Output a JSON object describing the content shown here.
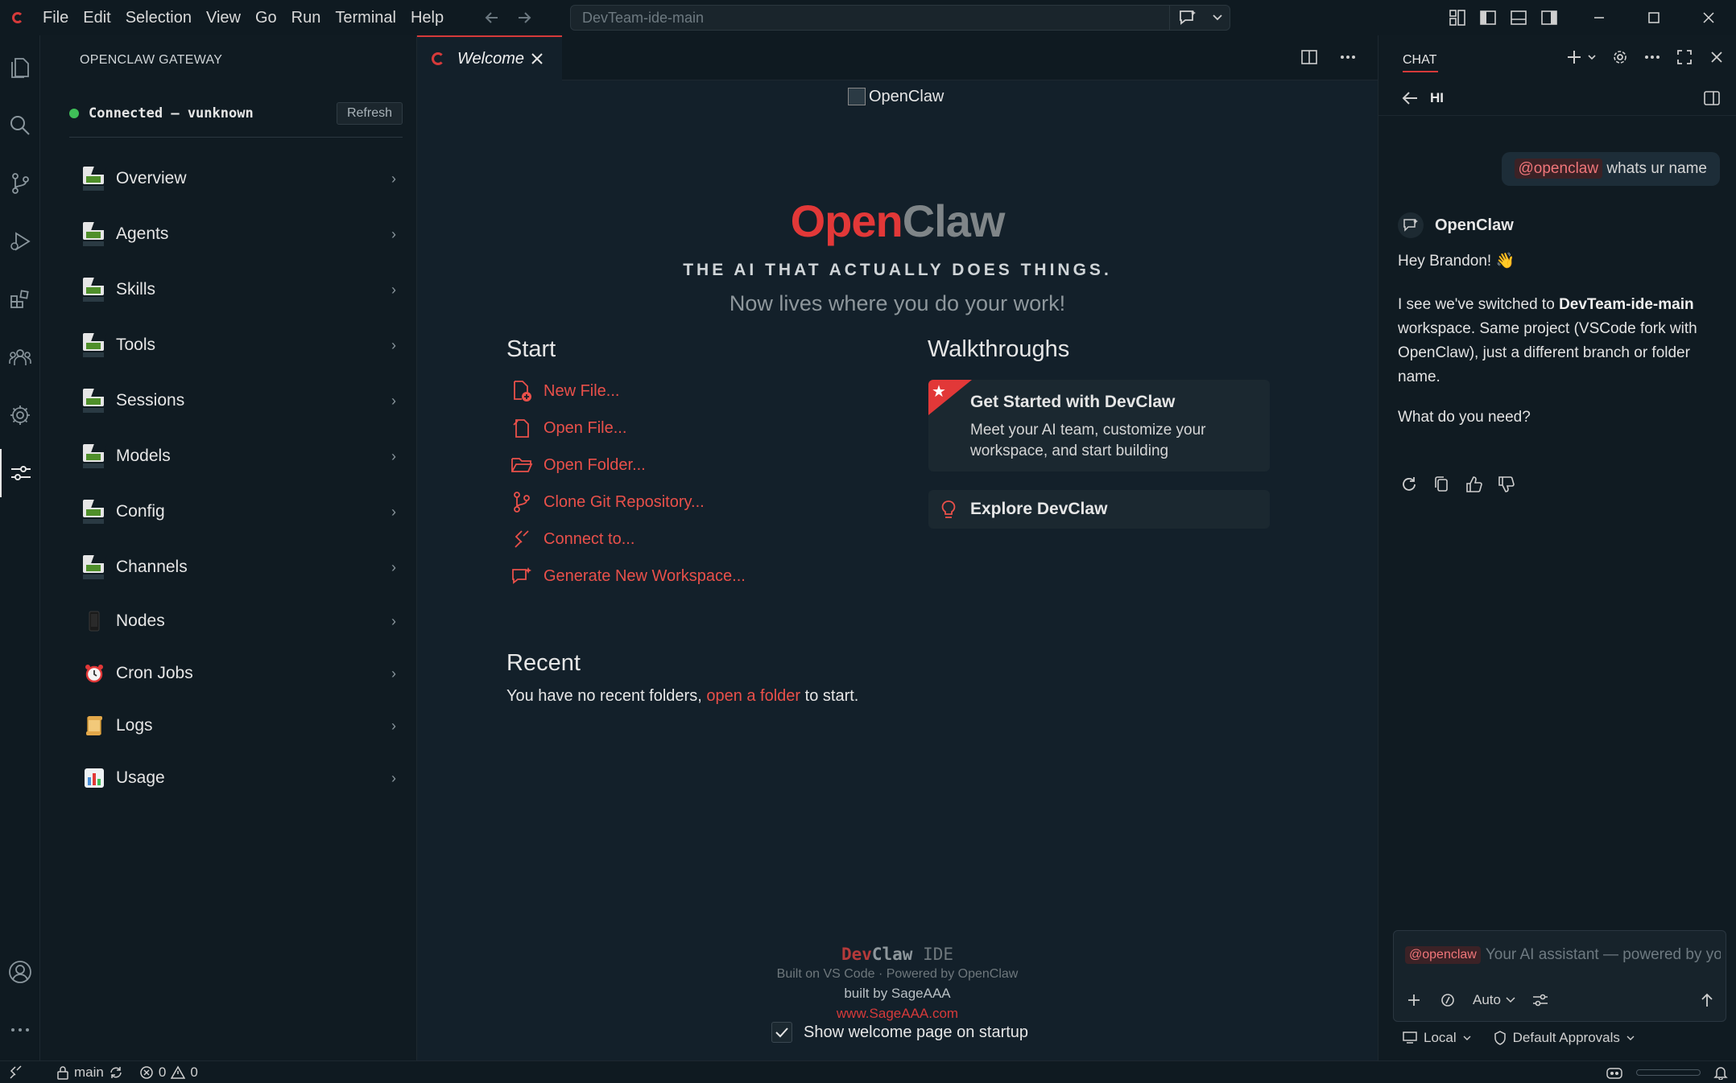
{
  "window": {
    "menu": [
      "File",
      "Edit",
      "Selection",
      "View",
      "Go",
      "Run",
      "Terminal",
      "Help"
    ],
    "command_center": "DevTeam-ide-main"
  },
  "sidebar": {
    "title": "OPENCLAW GATEWAY",
    "status": "Connected — vunknown",
    "refresh_label": "Refresh",
    "items": [
      {
        "label": "Overview",
        "icon": "broken-image-icon"
      },
      {
        "label": "Agents",
        "icon": "broken-image-icon"
      },
      {
        "label": "Skills",
        "icon": "broken-image-icon"
      },
      {
        "label": "Tools",
        "icon": "broken-image-icon"
      },
      {
        "label": "Sessions",
        "icon": "broken-image-icon"
      },
      {
        "label": "Models",
        "icon": "broken-image-icon"
      },
      {
        "label": "Config",
        "icon": "broken-image-icon"
      },
      {
        "label": "Channels",
        "icon": "broken-image-icon"
      },
      {
        "label": "Nodes",
        "icon": "phone-icon"
      },
      {
        "label": "Cron Jobs",
        "icon": "alarm-clock-icon"
      },
      {
        "label": "Logs",
        "icon": "scroll-icon"
      },
      {
        "label": "Usage",
        "icon": "bar-chart-icon"
      }
    ]
  },
  "editor": {
    "tab_label": "Welcome",
    "logo_alt": "OpenClaw",
    "hero_title_a": "Open",
    "hero_title_b": "Claw",
    "tagline": "THE AI THAT ACTUALLY DOES THINGS.",
    "subtitle": "Now lives where you do your work!",
    "start_heading": "Start",
    "start_items": [
      "New File...",
      "Open File...",
      "Open Folder...",
      "Clone Git Repository...",
      "Connect to...",
      "Generate New Workspace..."
    ],
    "recent_heading": "Recent",
    "recent_text_before": "You have no recent folders,",
    "recent_link": "open a folder",
    "recent_text_after": "to start.",
    "walkthroughs_heading": "Walkthroughs",
    "walk_card_title": "Get Started with DevClaw",
    "walk_card_desc": "Meet your AI team, customize your workspace, and start building",
    "explore_label": "Explore DevClaw",
    "footer_brand_dev": "Dev",
    "footer_brand_claw": "Claw",
    "footer_brand_ide": "IDE",
    "footer_built_on": "Built on VS Code · Powered by OpenClaw",
    "footer_built_by": "built by SageAAA",
    "footer_url": "www.SageAAA.com",
    "show_on_startup": "Show welcome page on startup"
  },
  "chat": {
    "tab_label": "CHAT",
    "thread_title": "HI",
    "user_mention": "@openclaw",
    "user_message": "whats ur name",
    "bot_name": "OpenClaw",
    "bot_greeting": "Hey Brandon! 👋",
    "bot_para_before": "I see we've switched to",
    "bot_para_bold": "DevTeam-ide-main",
    "bot_para_after": "workspace. Same project (VSCode fork with OpenClaw), just a different branch or folder name.",
    "bot_question": "What do you need?",
    "input_mention": "@openclaw",
    "input_placeholder": "Your AI assistant — powered by your",
    "mode_label": "Auto",
    "target_label": "Local",
    "approvals_label": "Default Approvals"
  },
  "statusbar": {
    "branch": "main",
    "errors": "0",
    "warnings": "0"
  },
  "colors": {
    "accent": "#e23838",
    "link": "#e9504a",
    "connected": "#3fbf58",
    "background": "#13202a"
  }
}
